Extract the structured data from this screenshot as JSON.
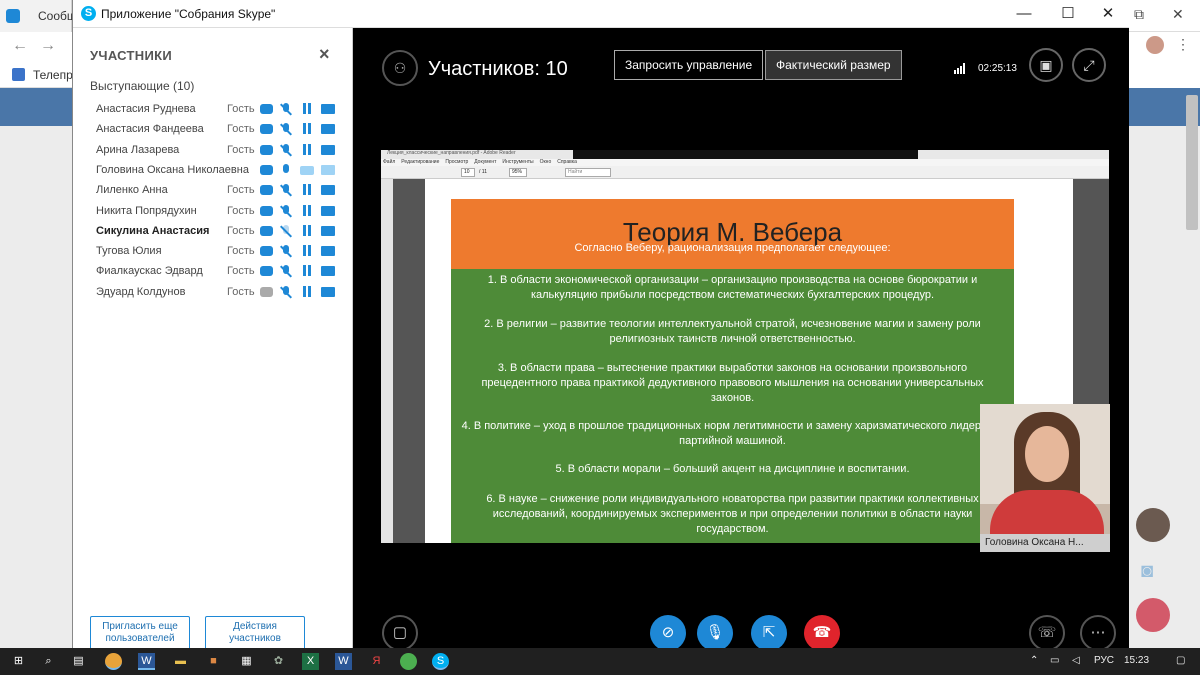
{
  "browser": {
    "tab_title": "Сообщ",
    "bookmark_label": "Телепро",
    "back_icon": "arrow-left-icon",
    "forward_icon": "arrow-right-icon"
  },
  "window": {
    "title": "Приложение \"Собрания Skype\"",
    "icon_letter": "S",
    "minimize": "—",
    "maximize": "☐",
    "close": "✕"
  },
  "participants_panel": {
    "title": "УЧАСТНИКИ",
    "close": "×",
    "group_label": "Выступающие (10)",
    "participants": [
      {
        "name": "Анастасия Руднева",
        "role": "Гость",
        "bold": false
      },
      {
        "name": "Анастасия Фандеева",
        "role": "Гость",
        "bold": false
      },
      {
        "name": "Арина Лазарева",
        "role": "Гость",
        "bold": false
      },
      {
        "name": "Головина Оксана Николаевна",
        "role": "",
        "bold": false
      },
      {
        "name": "Лиленко Анна",
        "role": "Гость",
        "bold": false
      },
      {
        "name": "Никита Попрядухин",
        "role": "Гость",
        "bold": false
      },
      {
        "name": "Сикулина Анастасия",
        "role": "Гость",
        "bold": true
      },
      {
        "name": "Тугова Юлия",
        "role": "Гость",
        "bold": false
      },
      {
        "name": "Фиалкаускас Эдвард",
        "role": "Гость",
        "bold": false
      },
      {
        "name": "Эдуард Колдунов",
        "role": "Гость",
        "bold": false
      }
    ],
    "invite_button": "Пригласить еще пользователей",
    "actions_button": "Действия участников"
  },
  "call": {
    "participants_count": "Участников: 10",
    "request_control": "Запросить управление",
    "actual_size": "Фактический размер",
    "timer": "02:25:13",
    "presenter_caption": "Головина Оксана Н..."
  },
  "shared_document": {
    "acrobat_title": "Лекция_классические_направления.pdf - Adobe Reader",
    "menu": [
      "Файл",
      "Редактирование",
      "Просмотр",
      "Документ",
      "Инструменты",
      "Окно",
      "Справка"
    ],
    "page_field": "10",
    "page_total": "/ 11",
    "zoom": "95%",
    "find_placeholder": "Найти",
    "slide_title": "Теория М. Вебера",
    "slide_subtitle": "Согласно Веберу, рационализация предполагает следующее:",
    "points": [
      "1. В области экономической организации – организацию производства на основе бюрократии и калькуляцию прибыли посредством систематических бухгалтерских процедур.",
      "2. В религии – развитие теологии интеллектуальной стратой, исчезновение магии и замену роли религиозных таинств личной ответственностью.",
      "3. В области права – вытеснение практики выработки законов на основании произвольного прецедентного права практикой дедуктивного правового мышления на основании универсальных законов.",
      "4. В политике – уход в прошлое традиционных норм легитимности и замену харизматического лидерства партийной машиной.",
      "5. В области морали – больший акцент на дисциплине и воспитании.",
      "6. В науке – снижение роли индивидуального новаторства при развитии практики коллективных исследований, координируемых экспериментов и при определении политики в области науки государством."
    ]
  },
  "taskbar": {
    "language": "РУС",
    "clock": "15:23"
  },
  "colors": {
    "skype_blue": "#1e88d6",
    "slide_orange": "#ee7a2e",
    "slide_green": "#4e8b38",
    "hangup_red": "#e0242c"
  }
}
